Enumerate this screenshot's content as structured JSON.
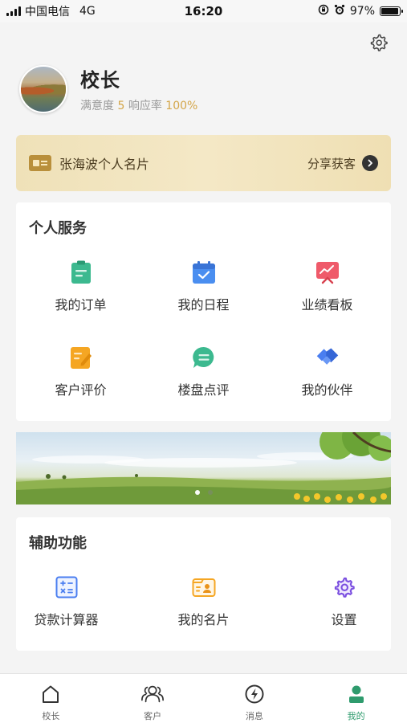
{
  "status_bar": {
    "carrier": "中国电信",
    "network": "4G",
    "time": "16:20",
    "battery": "97%",
    "battery_level": 0.97
  },
  "profile": {
    "name": "校长",
    "satisfaction_label": "满意度",
    "satisfaction_value": "5",
    "response_label": "响应率",
    "response_value": "100%"
  },
  "card_banner": {
    "title": "张海波个人名片",
    "share_label": "分享获客"
  },
  "personal_services": {
    "title": "个人服务",
    "items": [
      {
        "label": "我的订单",
        "icon": "clipboard-icon",
        "color": "#3cb98f"
      },
      {
        "label": "我的日程",
        "icon": "calendar-icon",
        "color": "#4a8ef0"
      },
      {
        "label": "业绩看板",
        "icon": "chart-board-icon",
        "color": "#ef5a6a"
      },
      {
        "label": "客户评价",
        "icon": "edit-note-icon",
        "color": "#f5a623"
      },
      {
        "label": "楼盘点评",
        "icon": "chat-bubble-icon",
        "color": "#3cb98f"
      },
      {
        "label": "我的伙伴",
        "icon": "handshake-icon",
        "color": "#4a7ef0"
      }
    ]
  },
  "banner": {
    "dots": 2,
    "active_dot": 0
  },
  "aux_functions": {
    "title": "辅助功能",
    "items": [
      {
        "label": "贷款计算器",
        "icon": "calculator-icon",
        "color": "#4a7ef0"
      },
      {
        "label": "我的名片",
        "icon": "id-card-icon",
        "color": "#f5a623"
      },
      {
        "label": "设置",
        "icon": "gear-icon",
        "color": "#7b4fe0"
      }
    ]
  },
  "tab_bar": {
    "tabs": [
      {
        "label": "校长",
        "icon": "home-icon"
      },
      {
        "label": "客户",
        "icon": "customers-icon"
      },
      {
        "label": "消息",
        "icon": "lightning-icon"
      },
      {
        "label": "我的",
        "icon": "person-icon"
      }
    ],
    "active_index": 3,
    "active_color": "#2e9b6d"
  }
}
